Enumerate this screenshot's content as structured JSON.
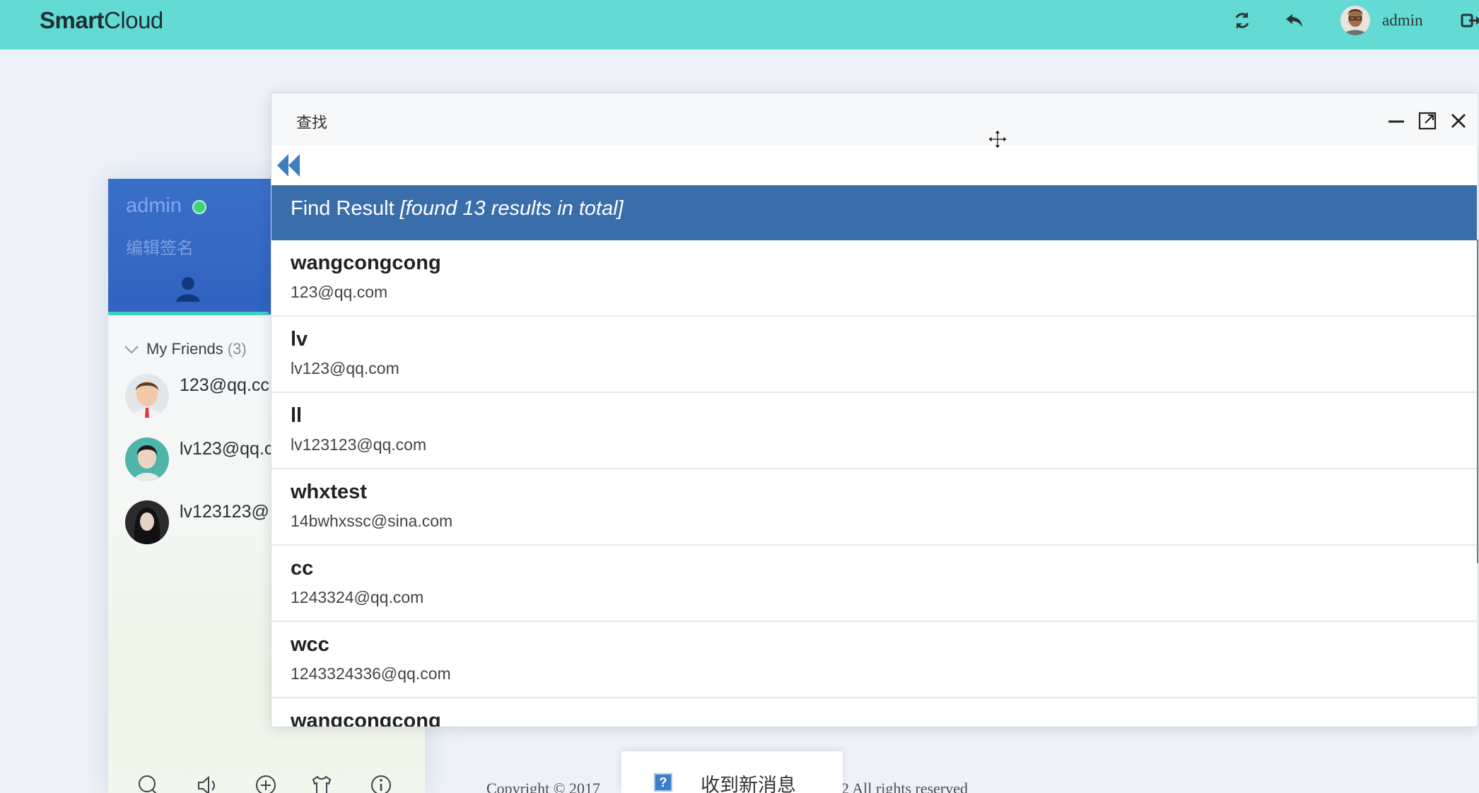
{
  "app": {
    "logo_bold": "Smart",
    "logo_light": "Cloud",
    "user": "admin",
    "header_icons": [
      "refresh-icon",
      "reply-icon",
      "logout-icon"
    ]
  },
  "panel": {
    "username": "admin",
    "status": "online",
    "signature_placeholder": "编辑签名",
    "group": {
      "label": "My Friends",
      "count": "(3)"
    },
    "friends": [
      {
        "name": "123@qq.cc"
      },
      {
        "name": "lv123@qq.c"
      },
      {
        "name": "lv123123@"
      }
    ],
    "footer_icons": [
      "search-icon",
      "sound-icon",
      "add-icon",
      "skin-icon",
      "info-icon"
    ]
  },
  "find_window": {
    "title": "查找",
    "header_label": "Find Result",
    "header_note": "[found 13 results in total]",
    "results": [
      {
        "name": "wangcongcong",
        "email": "123@qq.com"
      },
      {
        "name": "lv",
        "email": "lv123@qq.com"
      },
      {
        "name": "ll",
        "email": "lv123123@qq.com"
      },
      {
        "name": "whxtest",
        "email": "14bwhxssc@sina.com"
      },
      {
        "name": "cc",
        "email": "1243324@qq.com"
      },
      {
        "name": "wcc",
        "email": "1243324336@qq.com"
      },
      {
        "name": "wangcongcong",
        "email": ""
      }
    ]
  },
  "footer": {
    "copyright_left": "Copyright © 2017",
    "copyright_right": "2 All rights reserved",
    "toast_text": "收到新消息"
  },
  "colors": {
    "header_bg": "#63dbd4",
    "panel_head": "#2f63c0",
    "result_header": "#3a6eaa",
    "online": "#3ed37a"
  }
}
